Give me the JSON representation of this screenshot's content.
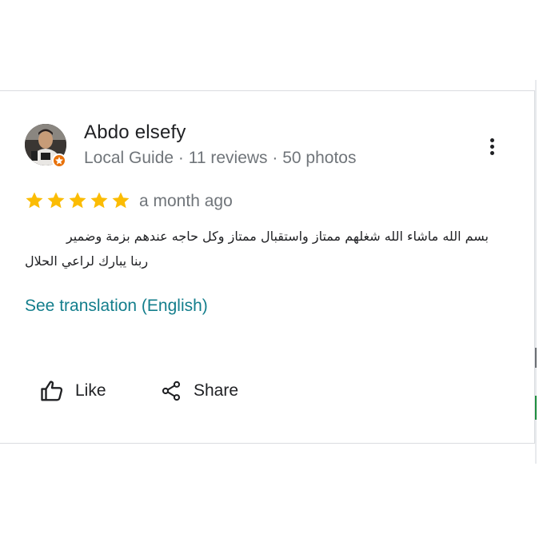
{
  "review": {
    "author_name": "Abdo elsefy",
    "author_meta": "Local Guide · 11 reviews · 50 photos",
    "rating": 5,
    "rating_max": 5,
    "date": "a month ago",
    "text_line1": "بسم الله ماشاء الله شغلهم ممتاز واستقبال ممتاز وكل حاجه عندهم بزمة وضمير",
    "text_line2": "ربنا يبارك لراعي الحلال",
    "translate_label": "See translation (English)"
  },
  "actions": {
    "like_label": "Like",
    "share_label": "Share"
  },
  "colors": {
    "star": "#fbbc04",
    "link": "#137e8c",
    "badge": "#e8710a",
    "text_primary": "#202124",
    "text_secondary": "#70757a"
  },
  "icons": {
    "menu": "more-vert-icon",
    "like": "thumb-up-icon",
    "share": "share-icon",
    "badge": "local-guide-badge-icon"
  }
}
